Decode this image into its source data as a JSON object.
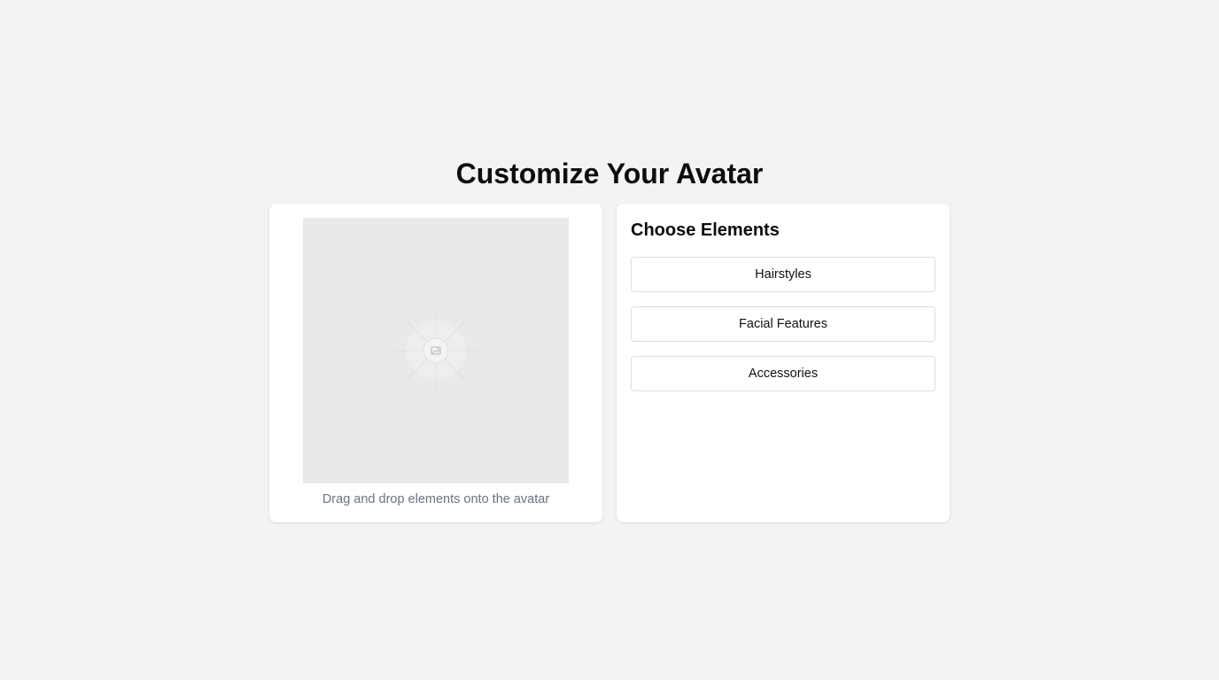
{
  "header": {
    "title": "Customize Your Avatar"
  },
  "avatar_panel": {
    "placeholder_icon": "image-placeholder-icon",
    "hint": "Drag and drop elements onto the avatar"
  },
  "elements_panel": {
    "title": "Choose Elements",
    "buttons": [
      {
        "label": "Hairstyles"
      },
      {
        "label": "Facial Features"
      },
      {
        "label": "Accessories"
      }
    ]
  },
  "colors": {
    "page_background": "#f2f3f5",
    "card_background": "#ffffff",
    "canvas_background": "#e9e9e9",
    "hint_text": "#6b7280",
    "button_border": "#dcdfe4"
  }
}
